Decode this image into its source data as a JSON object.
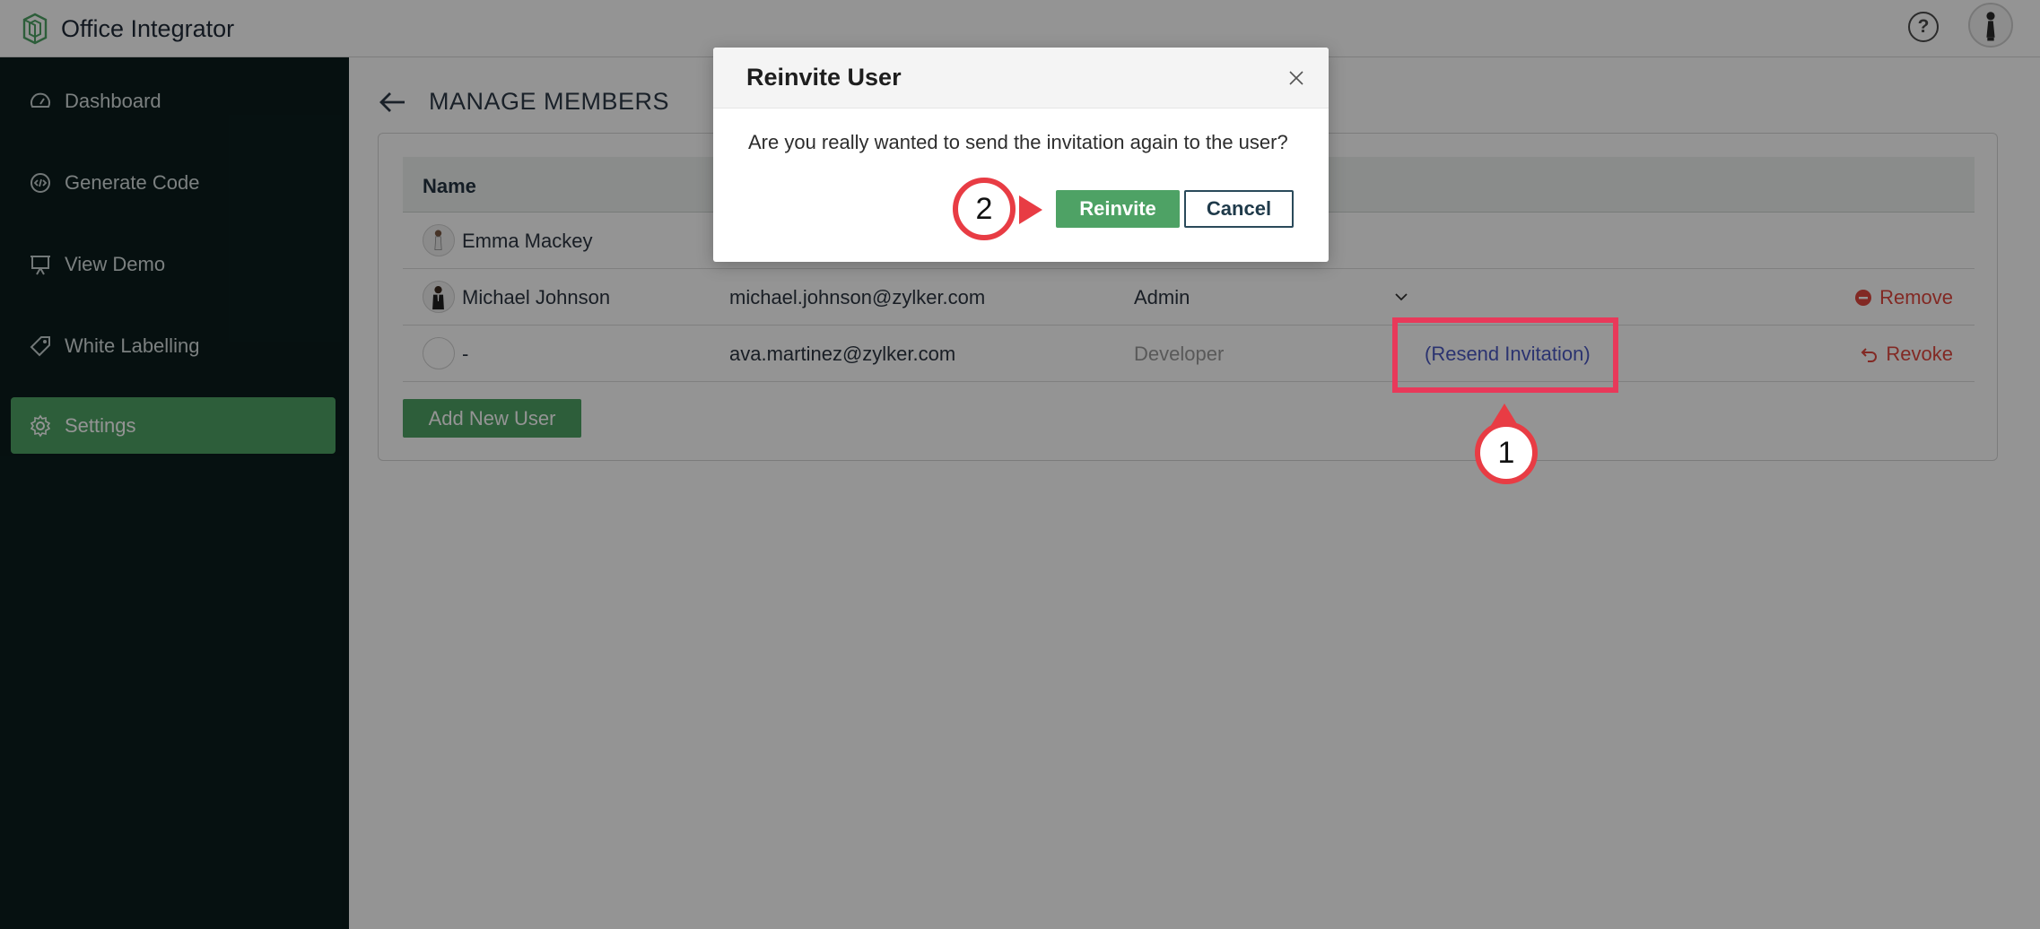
{
  "app": {
    "name": "Office Integrator",
    "help_icon": "question-circle-icon",
    "brand_color": "#4ea265"
  },
  "sidebar": {
    "items": [
      {
        "label": "Dashboard",
        "icon": "gauge-icon"
      },
      {
        "label": "Generate Code",
        "icon": "code-icon"
      },
      {
        "label": "View Demo",
        "icon": "presentation-icon"
      },
      {
        "label": "White Labelling",
        "icon": "tag-icon"
      },
      {
        "label": "Settings",
        "icon": "gear-icon",
        "active": true
      }
    ]
  },
  "main": {
    "title": "MANAGE MEMBERS",
    "table": {
      "headers": [
        "Name"
      ],
      "rows": [
        {
          "name": "Emma Mackey",
          "email": "",
          "role": "",
          "action": ""
        },
        {
          "name": "Michael Johnson",
          "email": "michael.johnson@zylker.com",
          "role": "Admin",
          "action": "Remove"
        },
        {
          "name": "-",
          "email": "ava.martinez@zylker.com",
          "role": "Developer",
          "status": "(Resend Invitation)",
          "action": "Revoke"
        }
      ]
    },
    "add_button": "Add New User"
  },
  "modal": {
    "title": "Reinvite User",
    "message": "Are you really wanted to send the invitation again to the user?",
    "confirm_label": "Reinvite",
    "cancel_label": "Cancel"
  },
  "annotations": {
    "step1": "1",
    "step2": "2",
    "highlight_color": "#e8395a"
  }
}
